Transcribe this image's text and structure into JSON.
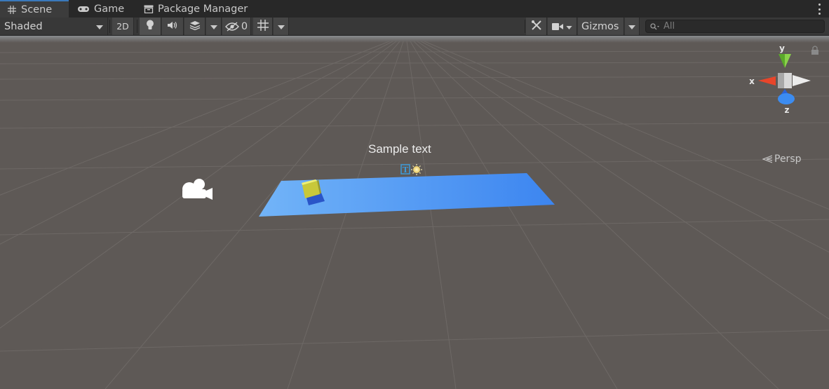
{
  "tabs": [
    {
      "label": "Scene",
      "icon": "hash-grid-icon",
      "active": true
    },
    {
      "label": "Game",
      "icon": "gamepad-icon",
      "active": false
    },
    {
      "label": "Package Manager",
      "icon": "package-icon",
      "active": false
    }
  ],
  "toolbar": {
    "draw_mode": "Shaded",
    "mode_2d": "2D",
    "hidden_count": "0",
    "gizmos": "Gizmos",
    "search_placeholder": "All"
  },
  "scene": {
    "sample_text": "Sample text",
    "orientation": {
      "x": "x",
      "y": "y",
      "z": "z",
      "projection": "Persp"
    }
  },
  "colors": {
    "background": "#5e5956",
    "plane_light": "#72b4f8",
    "plane_dark": "#3c85f0",
    "cube_top": "#e8e84a",
    "cube_side": "#2a55c8",
    "accent": "#3a79bb"
  }
}
